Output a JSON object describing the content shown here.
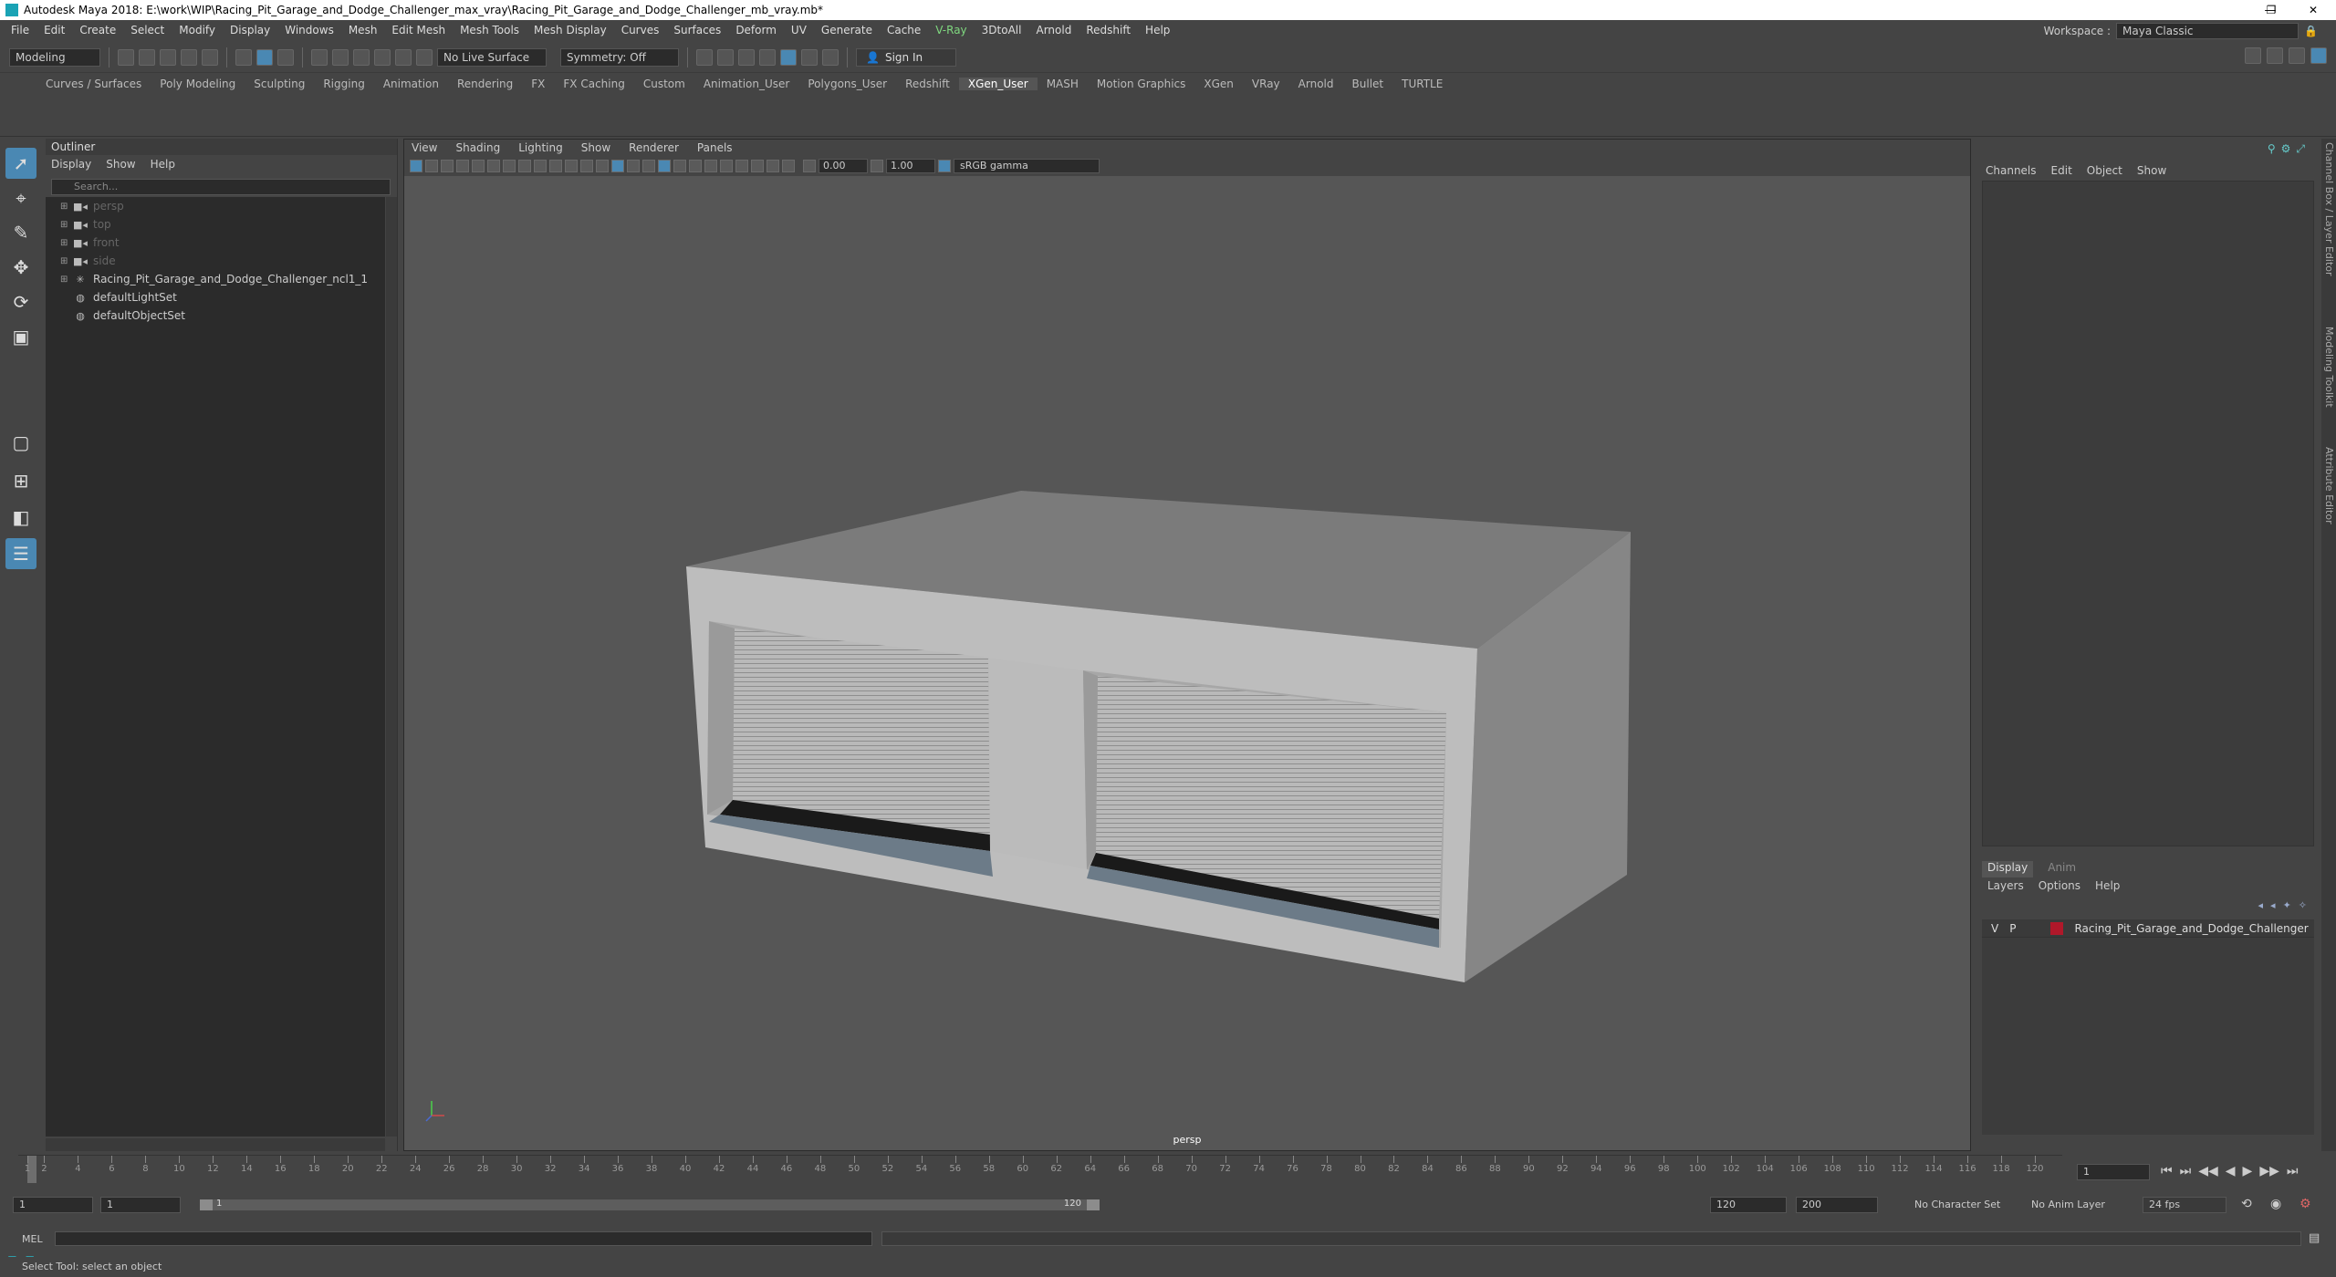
{
  "window": {
    "title": "Autodesk Maya 2018: E:\\work\\WIP\\Racing_Pit_Garage_and_Dodge_Challenger_max_vray\\Racing_Pit_Garage_and_Dodge_Challenger_mb_vray.mb*",
    "minimize": "—",
    "restore": "❐",
    "close": "✕"
  },
  "menus": [
    "File",
    "Edit",
    "Create",
    "Select",
    "Modify",
    "Display",
    "Windows",
    "Mesh",
    "Edit Mesh",
    "Mesh Tools",
    "Mesh Display",
    "Curves",
    "Surfaces",
    "Deform",
    "UV",
    "Generate",
    "Cache",
    "V-Ray",
    "3DtoAll",
    "Arnold",
    "Redshift",
    "Help"
  ],
  "workspace": {
    "label": "Workspace :",
    "value": "Maya Classic"
  },
  "statusline": {
    "mode": "Modeling",
    "live_surface": "No Live Surface",
    "symmetry": "Symmetry: Off",
    "sign_in": "Sign In"
  },
  "shelf_tabs": [
    "Curves / Surfaces",
    "Poly Modeling",
    "Sculpting",
    "Rigging",
    "Animation",
    "Rendering",
    "FX",
    "FX Caching",
    "Custom",
    "Animation_User",
    "Polygons_User",
    "Redshift",
    "XGen_User",
    "MASH",
    "Motion Graphics",
    "XGen",
    "VRay",
    "Arnold",
    "Bullet",
    "TURTLE"
  ],
  "active_shelf": "XGen_User",
  "outliner": {
    "title": "Outliner",
    "menu": [
      "Display",
      "Show",
      "Help"
    ],
    "search_placeholder": "Search...",
    "items": [
      {
        "label": "persp",
        "icon": "camera-icon",
        "dim": true
      },
      {
        "label": "top",
        "icon": "camera-icon",
        "dim": true
      },
      {
        "label": "front",
        "icon": "camera-icon",
        "dim": true
      },
      {
        "label": "side",
        "icon": "camera-icon",
        "dim": true
      },
      {
        "label": "Racing_Pit_Garage_and_Dodge_Challenger_ncl1_1",
        "icon": "group-icon",
        "dim": false
      },
      {
        "label": "defaultLightSet",
        "icon": "set-icon",
        "dim": false
      },
      {
        "label": "defaultObjectSet",
        "icon": "set-icon",
        "dim": false
      }
    ]
  },
  "viewport": {
    "menu": [
      "View",
      "Shading",
      "Lighting",
      "Show",
      "Renderer",
      "Panels"
    ],
    "exposure": "0.00",
    "gamma_value": "1.00",
    "color_space": "sRGB gamma",
    "camera": "persp"
  },
  "channel_box": {
    "menu": [
      "Channels",
      "Edit",
      "Object",
      "Show"
    ],
    "side_tabs": [
      "Channel Box / Layer Editor",
      "Modeling Toolkit",
      "Attribute Editor"
    ]
  },
  "layer_editor": {
    "tabs": [
      "Display",
      "Anim"
    ],
    "menu": [
      "Layers",
      "Options",
      "Help"
    ],
    "layer": {
      "v": "V",
      "p": "P",
      "name": "Racing_Pit_Garage_and_Dodge_Challenger",
      "color": "#b0182a"
    }
  },
  "timeline": {
    "ticks": [
      "2",
      "4",
      "6",
      "8",
      "10",
      "12",
      "14",
      "16",
      "18",
      "20",
      "22",
      "24",
      "26",
      "28",
      "30",
      "32",
      "34",
      "36",
      "38",
      "40",
      "42",
      "44",
      "46",
      "48",
      "50",
      "52",
      "54",
      "56",
      "58",
      "60",
      "62",
      "64",
      "66",
      "68",
      "70",
      "72",
      "74",
      "76",
      "78",
      "80",
      "82",
      "84",
      "86",
      "88",
      "90",
      "92",
      "94",
      "96",
      "98",
      "100",
      "102",
      "104",
      "106",
      "108",
      "110",
      "112",
      "114",
      "116",
      "118",
      "120"
    ],
    "first_tick": "1",
    "current_frame": "1",
    "playback_controls": [
      "⏮",
      "⏭",
      "◀◀",
      "◀",
      "▶",
      "▶▶",
      "⏭"
    ]
  },
  "range": {
    "start": "1",
    "start_inner": "1",
    "bar_start": "1",
    "bar_end": "120",
    "end_inner": "120",
    "end": "200",
    "character_set": "No Character Set",
    "anim_layer": "No Anim Layer",
    "fps": "24 fps"
  },
  "command": {
    "label": "MEL"
  },
  "help_line": "Select Tool: select an object"
}
